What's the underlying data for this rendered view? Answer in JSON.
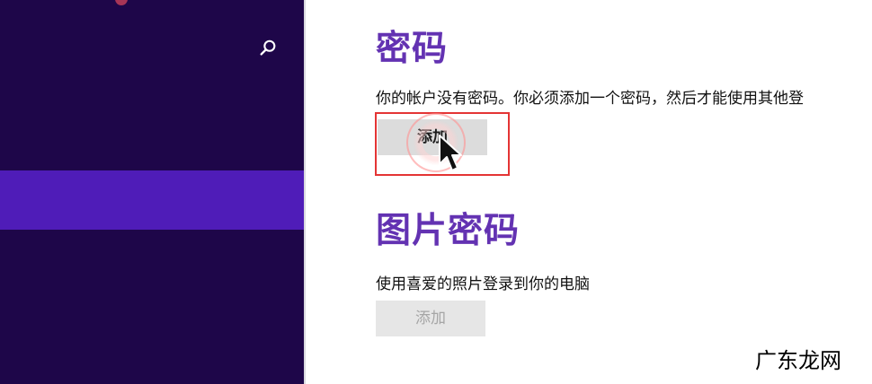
{
  "colors": {
    "sidebar_background": "#1e0649",
    "selected_item": "#4f1cb8",
    "section_title": "#6332b2",
    "highlight_border": "#e43434",
    "button_background": "#dcdcdc",
    "disabled_button_background": "#e6e6e6"
  },
  "icons": {
    "search": "search-icon",
    "cursor": "mouse-pointer-icon"
  },
  "password": {
    "title": "密码",
    "description": "你的帐户没有密码。你必须添加一个密码，然后才能使用其他登",
    "add_button": "添加"
  },
  "picture_password": {
    "title": "图片密码",
    "description": "使用喜爱的照片登录到你的电脑",
    "add_button": "添加"
  },
  "watermark": {
    "text": "广东龙网"
  }
}
